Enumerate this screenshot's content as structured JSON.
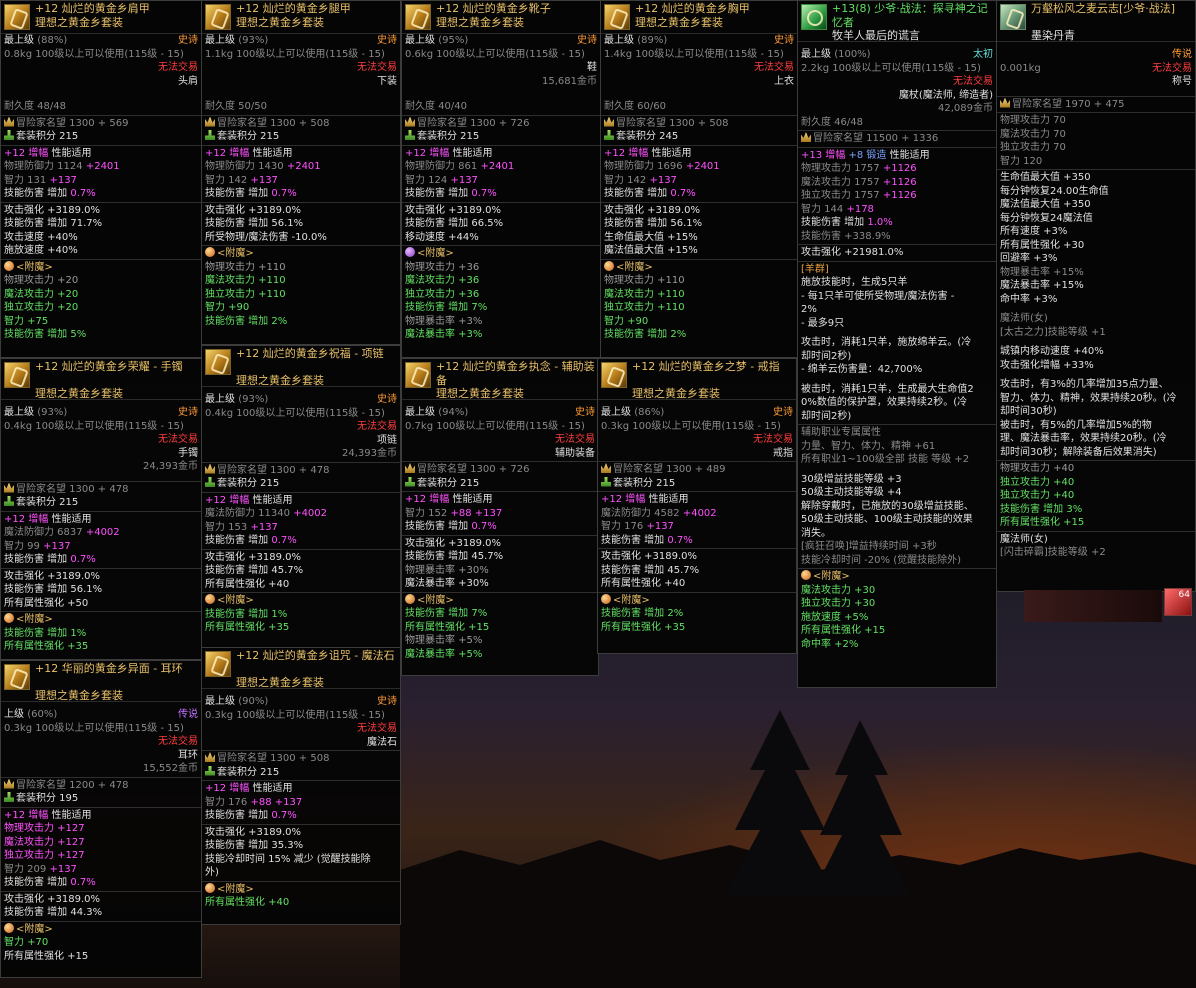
{
  "cards": {
    "shoulder": {
      "title": "+12 灿烂的黄金乡肩甲",
      "set": "理想之黄金乡套装",
      "grade": "最上级",
      "pct": "(88%)",
      "rarity": "史诗",
      "weight": "0.8kg",
      "req": "100级以上可以使用(115级 - 15)",
      "trade": "无法交易",
      "slot": "头肩",
      "dur": "耐久度 48/48",
      "fame": "冒险家名望 1300 + 569",
      "setpts": "套装积分 215",
      "amp": "+12 增幅",
      "amp_suffix": "性能适用",
      "l1": "物理防御力 1124",
      "l1b": "+2401",
      "l2": "智力 131",
      "l2b": "+137",
      "l3": "技能伤害 增加",
      "l3b": "0.7%",
      "s1": "攻击强化 +3189.0%",
      "s2": "技能伤害 增加 71.7%",
      "s3": "攻击速度 +40%",
      "s4": "施放速度 +40%",
      "ench": "<附魔>",
      "e1": "物理攻击力 +20",
      "e2": "魔法攻击力 +20",
      "e3": "独立攻击力 +20",
      "e4": "智力 +75",
      "e5": "技能伤害 增加 5%"
    },
    "pants": {
      "title": "+12 灿烂的黄金乡腿甲",
      "set": "理想之黄金乡套装",
      "grade": "最上级",
      "pct": "(93%)",
      "rarity": "史诗",
      "weight": "1.1kg",
      "req": "100级以上可以使用(115级 - 15)",
      "trade": "无法交易",
      "slot": "下装",
      "dur": "耐久度 50/50",
      "fame": "冒险家名望 1300 + 508",
      "setpts": "套装积分 215",
      "amp": "+12 增幅",
      "amp_suffix": "性能适用",
      "l1": "物理防御力 1430",
      "l1b": "+2401",
      "l2": "智力 142",
      "l2b": "+137",
      "l3": "技能伤害 增加",
      "l3b": "0.7%",
      "s1": "攻击强化 +3189.0%",
      "s2": "技能伤害 增加 56.1%",
      "s3": "所受物理/魔法伤害 -10.0%",
      "ench": "<附魔>",
      "e1": "物理攻击力 +110",
      "e2": "魔法攻击力 +110",
      "e3": "独立攻击力 +110",
      "e4": "智力 +90",
      "e5": "技能伤害 增加 2%"
    },
    "shoes": {
      "title": "+12 灿烂的黄金乡靴子",
      "set": "理想之黄金乡套装",
      "grade": "最上级",
      "pct": "(95%)",
      "rarity": "史诗",
      "weight": "0.6kg",
      "req": "100级以上可以使用(115级 - 15)",
      "slot": "鞋",
      "price": "15,681金币",
      "dur": "耐久度 40/40",
      "fame": "冒险家名望 1300 + 726",
      "setpts": "套装积分 215",
      "amp": "+12 增幅",
      "amp_suffix": "性能适用",
      "l1": "物理防御力 861",
      "l1b": "+2401",
      "l2": "智力 124",
      "l2b": "+137",
      "l3": "技能伤害 增加",
      "l3b": "0.7%",
      "s1": "攻击强化 +3189.0%",
      "s2": "技能伤害 增加 66.5%",
      "s3": "移动速度 +44%",
      "ench": "<附魔>",
      "e1": "物理攻击力 +36",
      "e2": "魔法攻击力 +36",
      "e3": "独立攻击力 +36",
      "e4": "技能伤害 增加 7%",
      "e5": "物理暴击率 +3%",
      "e6": "魔法暴击率 +3%"
    },
    "chest": {
      "title": "+12 灿烂的黄金乡胸甲",
      "set": "理想之黄金乡套装",
      "grade": "最上级",
      "pct": "(89%)",
      "rarity": "史诗",
      "weight": "1.4kg",
      "req": "100级以上可以使用(115级 - 15)",
      "trade": "无法交易",
      "slot": "上衣",
      "dur": "耐久度 60/60",
      "fame": "冒险家名望 1300 + 508",
      "setpts": "套装积分 245",
      "amp": "+12 增幅",
      "amp_suffix": "性能适用",
      "l1": "物理防御力 1696",
      "l1b": "+2401",
      "l2": "智力 142",
      "l2b": "+137",
      "l3": "技能伤害 增加",
      "l3b": "0.7%",
      "s1": "攻击强化 +3189.0%",
      "s2": "技能伤害 增加 56.1%",
      "s3": "生命值最大值 +15%",
      "s4": "魔法值最大值 +15%",
      "ench": "<附魔>",
      "e1": "物理攻击力 +110",
      "e2": "魔法攻击力 +110",
      "e3": "独立攻击力 +110",
      "e4": "智力 +90",
      "e5": "技能伤害 增加 2%"
    },
    "weapon": {
      "title": "+13(8) 少爷·战法：探寻神之记忆者",
      "sub": "牧羊人最后的谎言",
      "grade": "最上级",
      "pct": "(100%)",
      "rarity": "太初",
      "weight": "2.2kg",
      "req": "100级以上可以使用(115级 - 15)",
      "trade": "无法交易",
      "slot": "魔杖(魔法师, 缔造者)",
      "price": "42,089金币",
      "dur": "耐久度 46/48",
      "fame": "冒险家名望 11500 + 1336",
      "amp": "+13 增幅",
      "forge": "+8 锻造",
      "amp_suffix": "性能适用",
      "a1": "物理攻击力 1757",
      "a1b": "+1126",
      "a2": "魔法攻击力 1757",
      "a2b": "+1126",
      "a3": "独立攻击力 1757",
      "a3b": "+1126",
      "a4": "智力 144",
      "a4b": "+178",
      "a5": "技能伤害 增加",
      "a5b": "1.0%",
      "a6": "技能伤害 +338.9%",
      "s1": "攻击强化 +21981.0%",
      "sheep": "[羊群]",
      "t1": "施放技能时，生成5只羊",
      "t2": "- 每1只羊可使所受物理/魔法伤害 -",
      "t3": "2%",
      "t4": "- 最多9只",
      "t5": "攻击时，消耗1只羊，施放绵羊云。(冷",
      "t6": "却时间2秒)",
      "t7": "- 绵羊云伤害量：42,700%",
      "t8": "被击时，消耗1只羊，生成最大生命值2",
      "t9": "0%数值的保护罩，效果持续2秒。(冷",
      "t10": "却时间2秒)",
      "u1": "辅助职业专属属性",
      "u2": "力量、智力、体力、精神 +61",
      "u3": "所有职业1~100级全部 技能 等级 +2",
      "v1": "30级增益技能等级 +3",
      "v2": "50级主动技能等级 +4",
      "v3": "解除穿戴时，已施放的30级增益技能、",
      "v4": "50级主动技能、100级主动技能的效果",
      "v5": "消失。",
      "v6": "[疯狂召唤]增益持续时间 +3秒",
      "v7": "技能冷却时间 -20% (觉醒技能除外)",
      "ench": "<附魔>",
      "e1": "魔法攻击力 +30",
      "e2": "独立攻击力 +30",
      "e3": "施放速度 +5%",
      "e4": "所有属性强化 +15",
      "e5": "命中率 +2%"
    },
    "title_item": {
      "title": "万壑松风之麦云志[少爷·战法]",
      "sub": "墨染丹青",
      "rarity": "传说",
      "weight": "0.001kg",
      "trade": "无法交易",
      "slot": "称号",
      "fame": "冒险家名望 1970 + 475",
      "d1": "物理攻击力 70",
      "d2": "魔法攻击力 70",
      "d3": "独立攻击力 70",
      "d4": "智力 120",
      "w1": "生命值最大值 +350",
      "w2": "每分钟恢复24.00生命值",
      "w3": "魔法值最大值 +350",
      "w4": "每分钟恢复24魔法值",
      "w5": "所有速度 +3%",
      "w6": "所有属性强化 +30",
      "w7": "回避率 +3%",
      "w8": "物理暴击率 +15%",
      "w9": "魔法暴击率 +15%",
      "w10": "命中率 +3%",
      "x1": "魔法师(女)",
      "x2": "[太古之力]技能等级 +1",
      "y1": "城镇内移动速度 +40%",
      "y2": "攻击强化增幅 +33%",
      "z1": "攻击时，有3%的几率增加35点力量、",
      "z2": "智力、体力、精神，效果持续20秒。(冷",
      "z3": "却时间30秒)",
      "z4": "被击时，有5%的几率增加5%的物",
      "z5": "理、魔法暴击率，效果持续20秒。(冷",
      "z6": "却时间30秒；解除装备后效果消失)",
      "q1": "物理攻击力 +40",
      "q2": "独立攻击力 +40",
      "q3": "独立攻击力 +40",
      "q4": "技能伤害 增加 3%",
      "q5": "所有属性强化 +15",
      "r1": "魔法师(女)",
      "r2": "[闪击碎霸]技能等级 +2",
      "badge": "64"
    },
    "bracelet": {
      "title": "+12 灿烂的黄金乡荣耀 - 手镯",
      "set": "理想之黄金乡套装",
      "grade": "最上级",
      "pct": "(93%)",
      "rarity": "史诗",
      "weight": "0.4kg",
      "req": "100级以上可以使用(115级 - 15)",
      "trade": "无法交易",
      "slot": "手镯",
      "price": "24,393金币",
      "fame": "冒险家名望 1300 + 478",
      "setpts": "套装积分 215",
      "amp": "+12 增幅",
      "amp_suffix": "性能适用",
      "l1": "魔法防御力 6837",
      "l1b": "+4002",
      "l2": "智力 99",
      "l2b": "+137",
      "l3": "技能伤害 增加",
      "l3b": "0.7%",
      "s1": "攻击强化 +3189.0%",
      "s2": "技能伤害 增加 56.1%",
      "s3": "所有属性强化 +50",
      "ench": "<附魔>",
      "e1": "技能伤害 增加 1%",
      "e2": "所有属性强化 +35"
    },
    "necklace": {
      "title": "+12 灿烂的黄金乡祝福 - 项链",
      "set": "理想之黄金乡套装",
      "grade": "最上级",
      "pct": "(93%)",
      "rarity": "史诗",
      "weight": "0.4kg",
      "req": "100级以上可以使用(115级 - 15)",
      "trade": "无法交易",
      "slot": "项链",
      "price": "24,393金币",
      "fame": "冒险家名望 1300 + 478",
      "setpts": "套装积分 215",
      "amp": "+12 增幅",
      "amp_suffix": "性能适用",
      "l1": "魔法防御力 11340",
      "l1b": "+4002",
      "l2": "智力 153",
      "l2b": "+137",
      "l3": "技能伤害 增加",
      "l3b": "0.7%",
      "s1": "攻击强化 +3189.0%",
      "s2": "技能伤害 增加 45.7%",
      "s3": "所有属性强化 +40",
      "ench": "<附魔>",
      "e1": "技能伤害 增加 1%",
      "e2": "所有属性强化 +35"
    },
    "support": {
      "title": "+12 灿烂的黄金乡执念 - 辅助装备",
      "set": "理想之黄金乡套装",
      "grade": "最上级",
      "pct": "(94%)",
      "rarity": "史诗",
      "weight": "0.7kg",
      "req": "100级以上可以使用(115级 - 15)",
      "trade": "无法交易",
      "slot": "辅助装备",
      "fame": "冒险家名望 1300 + 726",
      "setpts": "套装积分 215",
      "amp": "+12 增幅",
      "amp_suffix": "性能适用",
      "l1": "智力 152",
      "l1b": "+88",
      "l1c": "+137",
      "l2": "技能伤害 增加",
      "l2b": "0.7%",
      "s1": "攻击强化 +3189.0%",
      "s2": "技能伤害 增加 45.7%",
      "s3": "物理暴击率 +30%",
      "s4": "魔法暴击率 +30%",
      "ench": "<附魔>",
      "e1": "技能伤害 增加 7%",
      "e2": "所有属性强化 +15",
      "e3": "物理暴击率 +5%",
      "e4": "魔法暴击率 +5%"
    },
    "ring": {
      "title": "+12 灿烂的黄金乡之梦 - 戒指",
      "set": "理想之黄金乡套装",
      "grade": "最上级",
      "pct": "(86%)",
      "rarity": "史诗",
      "weight": "0.3kg",
      "req": "100级以上可以使用(115级 - 15)",
      "trade": "无法交易",
      "slot": "戒指",
      "fame": "冒险家名望 1300 + 489",
      "setpts": "套装积分 215",
      "amp": "+12 增幅",
      "amp_suffix": "性能适用",
      "l1": "魔法防御力 4582",
      "l1b": "+4002",
      "l2": "智力 176",
      "l2b": "+137",
      "l3": "技能伤害 增加",
      "l3b": "0.7%",
      "s1": "攻击强化 +3189.0%",
      "s2": "技能伤害 增加 45.7%",
      "s3": "所有属性强化 +40",
      "ench": "<附魔>",
      "e1": "技能伤害 增加 2%",
      "e2": "所有属性强化 +35"
    },
    "earring": {
      "title": "+12 华丽的黄金乡异面 - 耳环",
      "set": "理想之黄金乡套装",
      "grade": "上级",
      "pct": "(60%)",
      "rarity": "传说",
      "weight": "0.3kg",
      "req": "100级以上可以使用(115级 - 15)",
      "trade": "无法交易",
      "slot": "耳环",
      "price": "15,552金币",
      "fame": "冒险家名望 1200 + 478",
      "setpts": "套装积分 195",
      "amp": "+12 增幅",
      "amp_suffix": "性能适用",
      "l1": "物理攻击力 +127",
      "l2": "魔法攻击力 +127",
      "l3": "独立攻击力 +127",
      "l4": "智力 209",
      "l4b": "+137",
      "l5": "技能伤害 增加",
      "l5b": "0.7%",
      "s1": "攻击强化 +3189.0%",
      "s2": "技能伤害 增加 44.3%",
      "ench": "<附魔>",
      "e1": "智力 +70",
      "e2": "所有属性强化 +15"
    },
    "stone": {
      "title": "+12 灿烂的黄金乡诅咒 - 魔法石",
      "set": "理想之黄金乡套装",
      "grade": "最上级",
      "pct": "(90%)",
      "rarity": "史诗",
      "weight": "0.3kg",
      "req": "100级以上可以使用(115级 - 15)",
      "trade": "无法交易",
      "slot": "魔法石",
      "fame": "冒险家名望 1300 + 508",
      "setpts": "套装积分 215",
      "amp": "+12 增幅",
      "amp_suffix": "性能适用",
      "l1": "智力 176",
      "l1b": "+88",
      "l1c": "+137",
      "l2": "技能伤害 增加",
      "l2b": "0.7%",
      "s1": "攻击强化 +3189.0%",
      "s2": "技能伤害 增加 35.3%",
      "s3": "技能冷却时间 15% 减少 (觉醒技能除",
      "s4": "外)",
      "ench": "<附魔>",
      "e1": "所有属性强化 +40"
    }
  }
}
